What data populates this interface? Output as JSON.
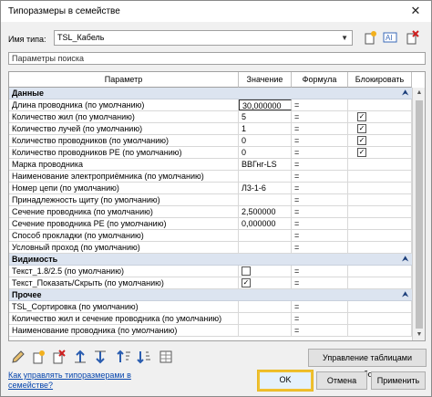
{
  "window": {
    "title": "Типоразмеры в семействе",
    "close_glyph": "✕"
  },
  "type": {
    "label": "Имя типа:",
    "value": "TSL_Кабель"
  },
  "search": {
    "placeholder": "Параметры поиска"
  },
  "table": {
    "headers": [
      "Параметр",
      "Значение",
      "Формула",
      "Блокировать"
    ],
    "sections": [
      {
        "title": "Данные",
        "rows": [
          {
            "name": "Длина проводника (по умолчанию)",
            "value": "30,000000",
            "formula": "=",
            "lock": null,
            "editing": true
          },
          {
            "name": "Количество жил (по умолчанию)",
            "value": "5",
            "formula": "=",
            "lock": true
          },
          {
            "name": "Количество лучей (по умолчанию)",
            "value": "1",
            "formula": "=",
            "lock": true
          },
          {
            "name": "Количество проводников (по умолчанию)",
            "value": "0",
            "formula": "=",
            "lock": true
          },
          {
            "name": "Количество проводников PE (по умолчанию)",
            "value": "0",
            "formula": "=",
            "lock": true
          },
          {
            "name": "Марка проводника",
            "value": "ВВГнг-LS",
            "formula": "=",
            "lock": null
          },
          {
            "name": "Наименование электроприёмника (по умолчанию)",
            "value": "",
            "formula": "=",
            "lock": null
          },
          {
            "name": "Номер цепи (по умолчанию)",
            "value": "Л3-1-6",
            "formula": "=",
            "lock": null
          },
          {
            "name": "Принадлежность щиту (по умолчанию)",
            "value": "",
            "formula": "=",
            "lock": null
          },
          {
            "name": "Сечение проводника (по умолчанию)",
            "value": "2,500000",
            "formula": "=",
            "lock": null
          },
          {
            "name": "Сечение проводника PE (по умолчанию)",
            "value": "0,000000",
            "formula": "=",
            "lock": null
          },
          {
            "name": "Способ прокладки (по умолчанию)",
            "value": "",
            "formula": "=",
            "lock": null
          },
          {
            "name": "Условный проход (по умолчанию)",
            "value": "",
            "formula": "=",
            "lock": null
          }
        ]
      },
      {
        "title": "Видимость",
        "rows": [
          {
            "name": "Текст_1.8/2.5 (по умолчанию)",
            "value": "",
            "formula": "=",
            "lock": null,
            "checkbox": false
          },
          {
            "name": "Текст_Показать/Скрыть (по умолчанию)",
            "value": "",
            "formula": "=",
            "lock": null,
            "checkbox": true
          }
        ]
      },
      {
        "title": "Прочее",
        "rows": [
          {
            "name": "TSL_Сортировка (по умолчанию)",
            "value": "",
            "formula": "=",
            "lock": null
          },
          {
            "name": "Количество жил и сечение проводника (по умолчанию)",
            "value": "",
            "formula": "=",
            "lock": null
          },
          {
            "name": "Наименование проводника (по умолчанию)",
            "value": "",
            "formula": "=",
            "lock": null
          }
        ]
      }
    ]
  },
  "bottom_icons": [
    "pencil-icon",
    "new-param-icon",
    "delete-param-icon",
    "move-up-icon",
    "move-down-icon",
    "sort-asc-icon",
    "sort-desc-icon",
    "lookup-table-icon"
  ],
  "buttons": {
    "manage_tables": "Управление таблицами выбора",
    "ok": "OK",
    "cancel": "Отмена",
    "apply": "Применить"
  },
  "help_link": "Как управлять типоразмерами в семействе?",
  "colors": {
    "section_bg": "#dce4f0",
    "ok_highlight": "#f0c030",
    "link": "#0645ad"
  }
}
